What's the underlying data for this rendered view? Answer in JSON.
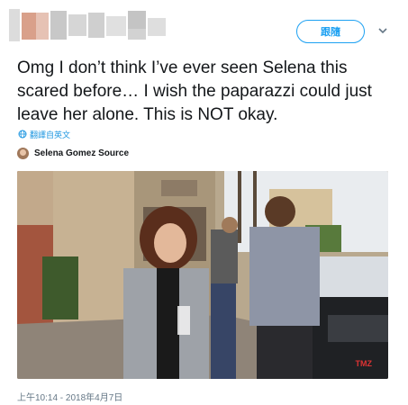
{
  "header": {
    "follow_label": "跟隨"
  },
  "tweet": {
    "text": "Omg I don’t think I’ve ever seen Selena this scared before… I wish the paparazzi could just leave her alone. This is NOT okay.",
    "translate_label": "翻譯自英文",
    "quoted_account": "Selena Gomez Source",
    "timestamp": "上午10:14 - 2018年4月7日"
  },
  "colors": {
    "accent": "#1da1f2",
    "text": "#14171a",
    "muted": "#657786"
  },
  "icons": {
    "more": "chevron-down-icon",
    "translate": "globe-icon"
  }
}
